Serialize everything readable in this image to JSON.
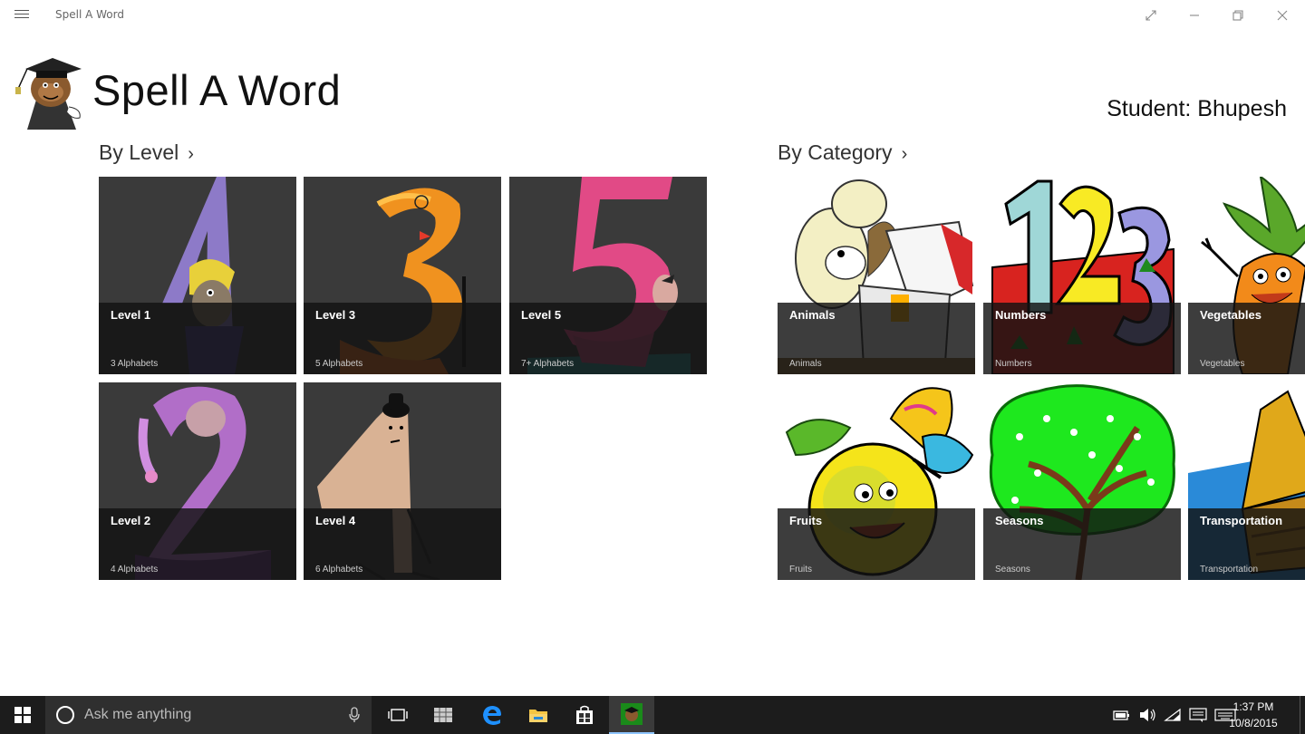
{
  "window": {
    "title": "Spell A Word",
    "menu_icon": "hamburger-icon",
    "controls": [
      "fullscreen-icon",
      "minimize-icon",
      "restore-icon",
      "close-icon"
    ]
  },
  "header": {
    "app_title": "Spell A Word",
    "student_label": "Student:",
    "student_name": "Bhupesh"
  },
  "sections": {
    "by_level": {
      "label": "By Level",
      "chevron": "›",
      "tiles": [
        {
          "title": "Level 1",
          "subtitle": "3 Alphabets"
        },
        {
          "title": "Level 3",
          "subtitle": "5 Alphabets"
        },
        {
          "title": "Level 5",
          "subtitle": "7+ Alphabets"
        },
        {
          "title": "Level 2",
          "subtitle": "4 Alphabets"
        },
        {
          "title": "Level 4",
          "subtitle": "6 Alphabets"
        }
      ]
    },
    "by_category": {
      "label": "By Category",
      "chevron": "›",
      "tiles": [
        {
          "title": "Animals",
          "subtitle": "Animals"
        },
        {
          "title": "Numbers",
          "subtitle": "Numbers"
        },
        {
          "title": "Vegetables",
          "subtitle": "Vegetables"
        },
        {
          "title": "Fruits",
          "subtitle": "Fruits"
        },
        {
          "title": "Seasons",
          "subtitle": "Seasons"
        },
        {
          "title": "Transportation",
          "subtitle": "Transportation"
        }
      ]
    }
  },
  "taskbar": {
    "search_placeholder": "Ask me anything",
    "time": "1:37 PM",
    "date": "10/8/2015",
    "icons": [
      "task-view-icon",
      "store-grid-icon",
      "edge-icon",
      "file-explorer-icon",
      "windows-store-icon",
      "spell-a-word-app-icon"
    ],
    "tray_icons": [
      "battery-icon",
      "volume-icon",
      "wifi-icon",
      "notifications-icon",
      "keyboard-icon"
    ]
  },
  "colors": {
    "tile_bg": "#3a3a3a",
    "tile_overlay": "#121212",
    "taskbar_bg": "#1c1c1c",
    "accent": "#0078d7"
  }
}
